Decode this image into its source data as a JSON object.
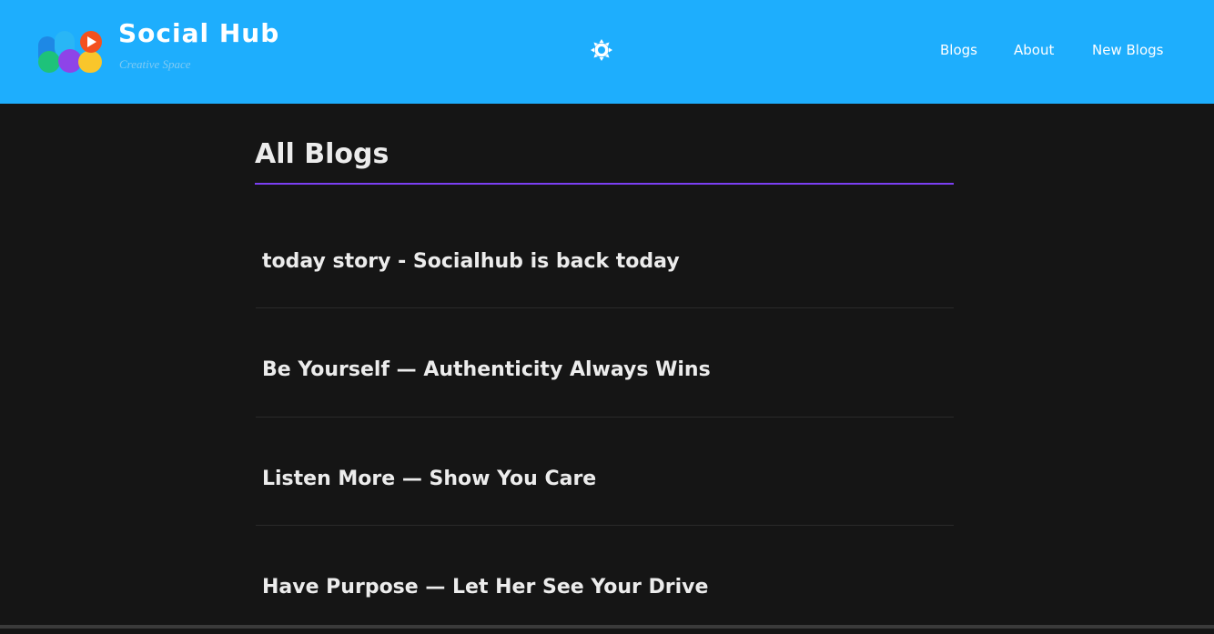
{
  "brand": {
    "title": "Social Hub",
    "subtitle": "Creative Space",
    "logo_icon": "social-hub-logo"
  },
  "header": {
    "theme_toggle_icon": "sun-icon",
    "nav": [
      {
        "label": "Blogs"
      },
      {
        "label": "About"
      },
      {
        "label": "New Blogs"
      }
    ]
  },
  "main": {
    "page_title": "All Blogs",
    "blogs": [
      {
        "title": "today story - Socialhub is back today"
      },
      {
        "title": "Be Yourself — Authenticity Always Wins"
      },
      {
        "title": "Listen More — Show You Care"
      },
      {
        "title": "Have Purpose — Let Her See Your Drive"
      }
    ]
  },
  "colors": {
    "header_bg": "#1eaefd",
    "page_bg": "#151515",
    "accent_rule": "#7b3ff2",
    "text": "#ececec"
  }
}
